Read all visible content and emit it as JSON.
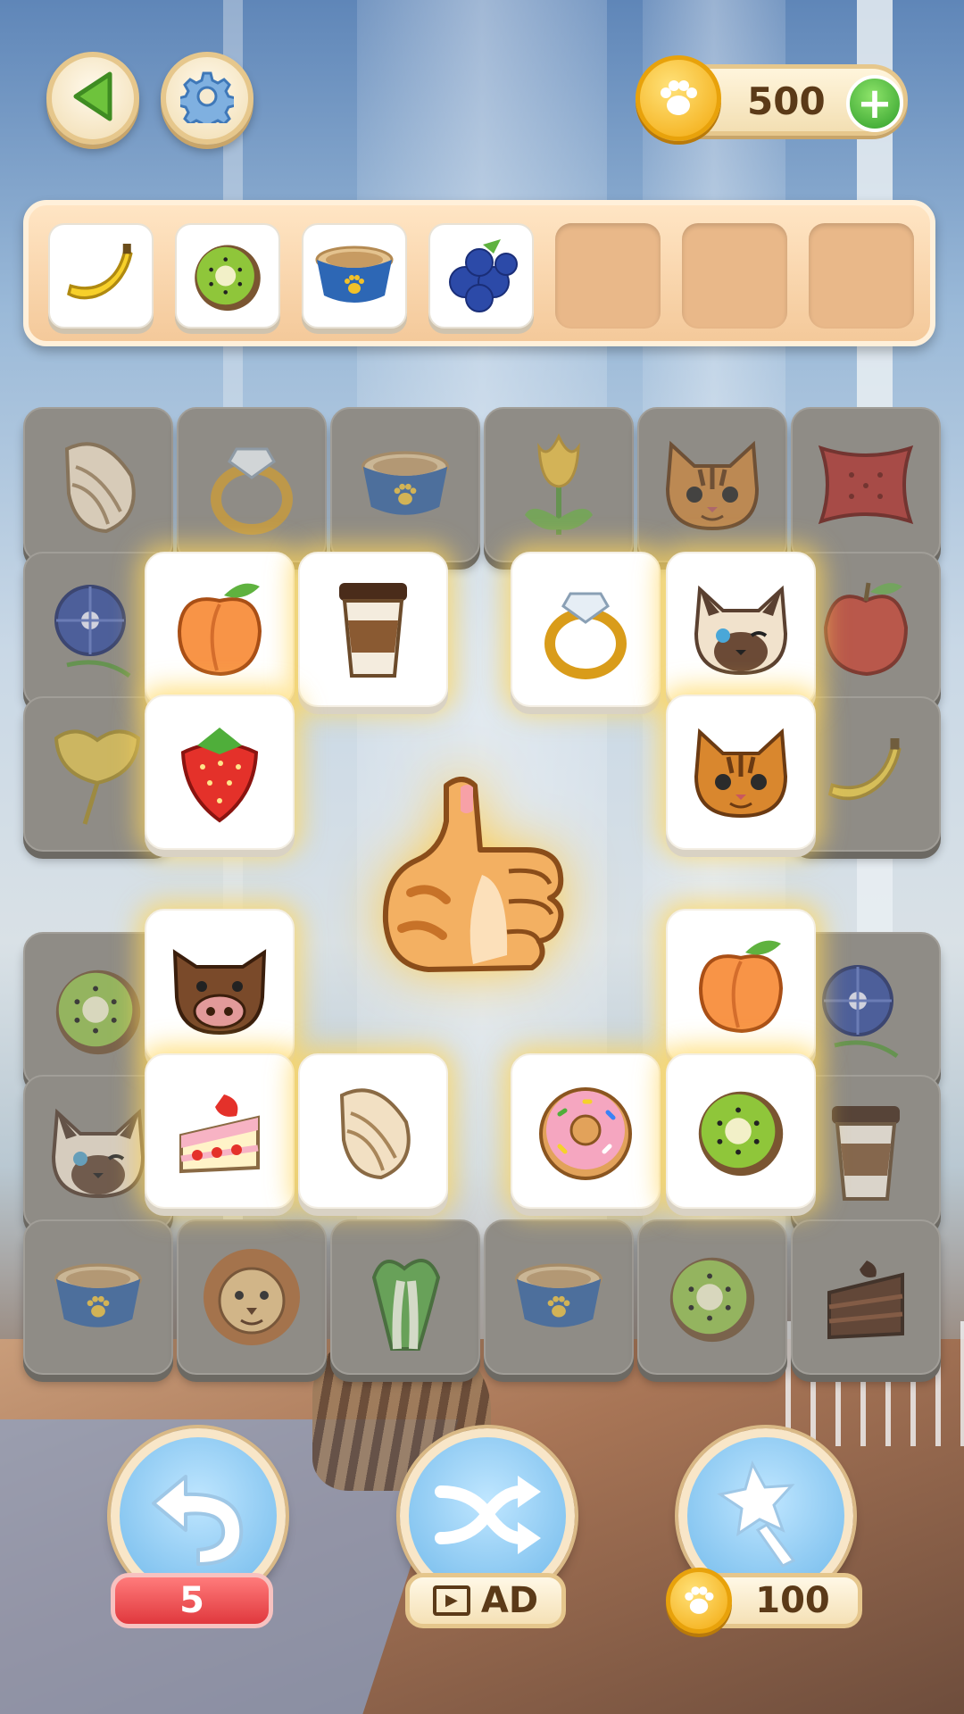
{
  "coins": {
    "value": "500",
    "add_label": "+"
  },
  "tray": {
    "slots": [
      "banana",
      "kiwi",
      "pet-bowl",
      "blueberries",
      "",
      "",
      ""
    ]
  },
  "board": {
    "tiles": [
      {
        "item": "seashell",
        "state": "dim"
      },
      {
        "item": "ring",
        "state": "dim"
      },
      {
        "item": "pet-bowl",
        "state": "dim"
      },
      {
        "item": "tulip",
        "state": "dim"
      },
      {
        "item": "tabby-cat",
        "state": "dim"
      },
      {
        "item": "pillow",
        "state": "dim"
      },
      {
        "item": "morning-glory",
        "state": "dim"
      },
      {
        "item": "apple",
        "state": "dim"
      },
      {
        "item": "ginkgo-leaf",
        "state": "dim"
      },
      {
        "item": "banana",
        "state": "dim"
      },
      {
        "item": "kiwi",
        "state": "dim"
      },
      {
        "item": "morning-glory",
        "state": "dim"
      },
      {
        "item": "siamese-cat",
        "state": "dim"
      },
      {
        "item": "coffee-cup",
        "state": "dim"
      },
      {
        "item": "pet-bowl",
        "state": "dim"
      },
      {
        "item": "lion",
        "state": "dim"
      },
      {
        "item": "bok-choy",
        "state": "dim"
      },
      {
        "item": "pet-bowl",
        "state": "dim"
      },
      {
        "item": "kiwi",
        "state": "dim"
      },
      {
        "item": "chocolate-cake",
        "state": "dim"
      },
      {
        "item": "peach",
        "state": "selectable"
      },
      {
        "item": "coffee-cup",
        "state": "selectable"
      },
      {
        "item": "ring",
        "state": "selectable"
      },
      {
        "item": "siamese-cat",
        "state": "selectable"
      },
      {
        "item": "strawberry",
        "state": "selectable"
      },
      {
        "item": "tabby-cat",
        "state": "selectable"
      },
      {
        "item": "boar",
        "state": "selectable"
      },
      {
        "item": "peach",
        "state": "selectable"
      },
      {
        "item": "strawberry-cake",
        "state": "selectable"
      },
      {
        "item": "seashell",
        "state": "selectable"
      },
      {
        "item": "donut",
        "state": "selectable"
      },
      {
        "item": "kiwi",
        "state": "selectable"
      }
    ]
  },
  "center_icon": "thumbs-up-paw-icon",
  "boosters": {
    "undo": {
      "icon": "undo-icon",
      "count": "5"
    },
    "shuffle": {
      "icon": "shuffle-icon",
      "play_icon": "▶",
      "cost": "AD"
    },
    "magic": {
      "icon": "magic-wand-icon",
      "cost": "100"
    }
  },
  "colors": {
    "tray": "#f4c99a",
    "tile_dim": "#8f8c86",
    "tile_lit": "#ffffff",
    "glow": "#ffd65a",
    "booster": "#6fb8ea"
  }
}
